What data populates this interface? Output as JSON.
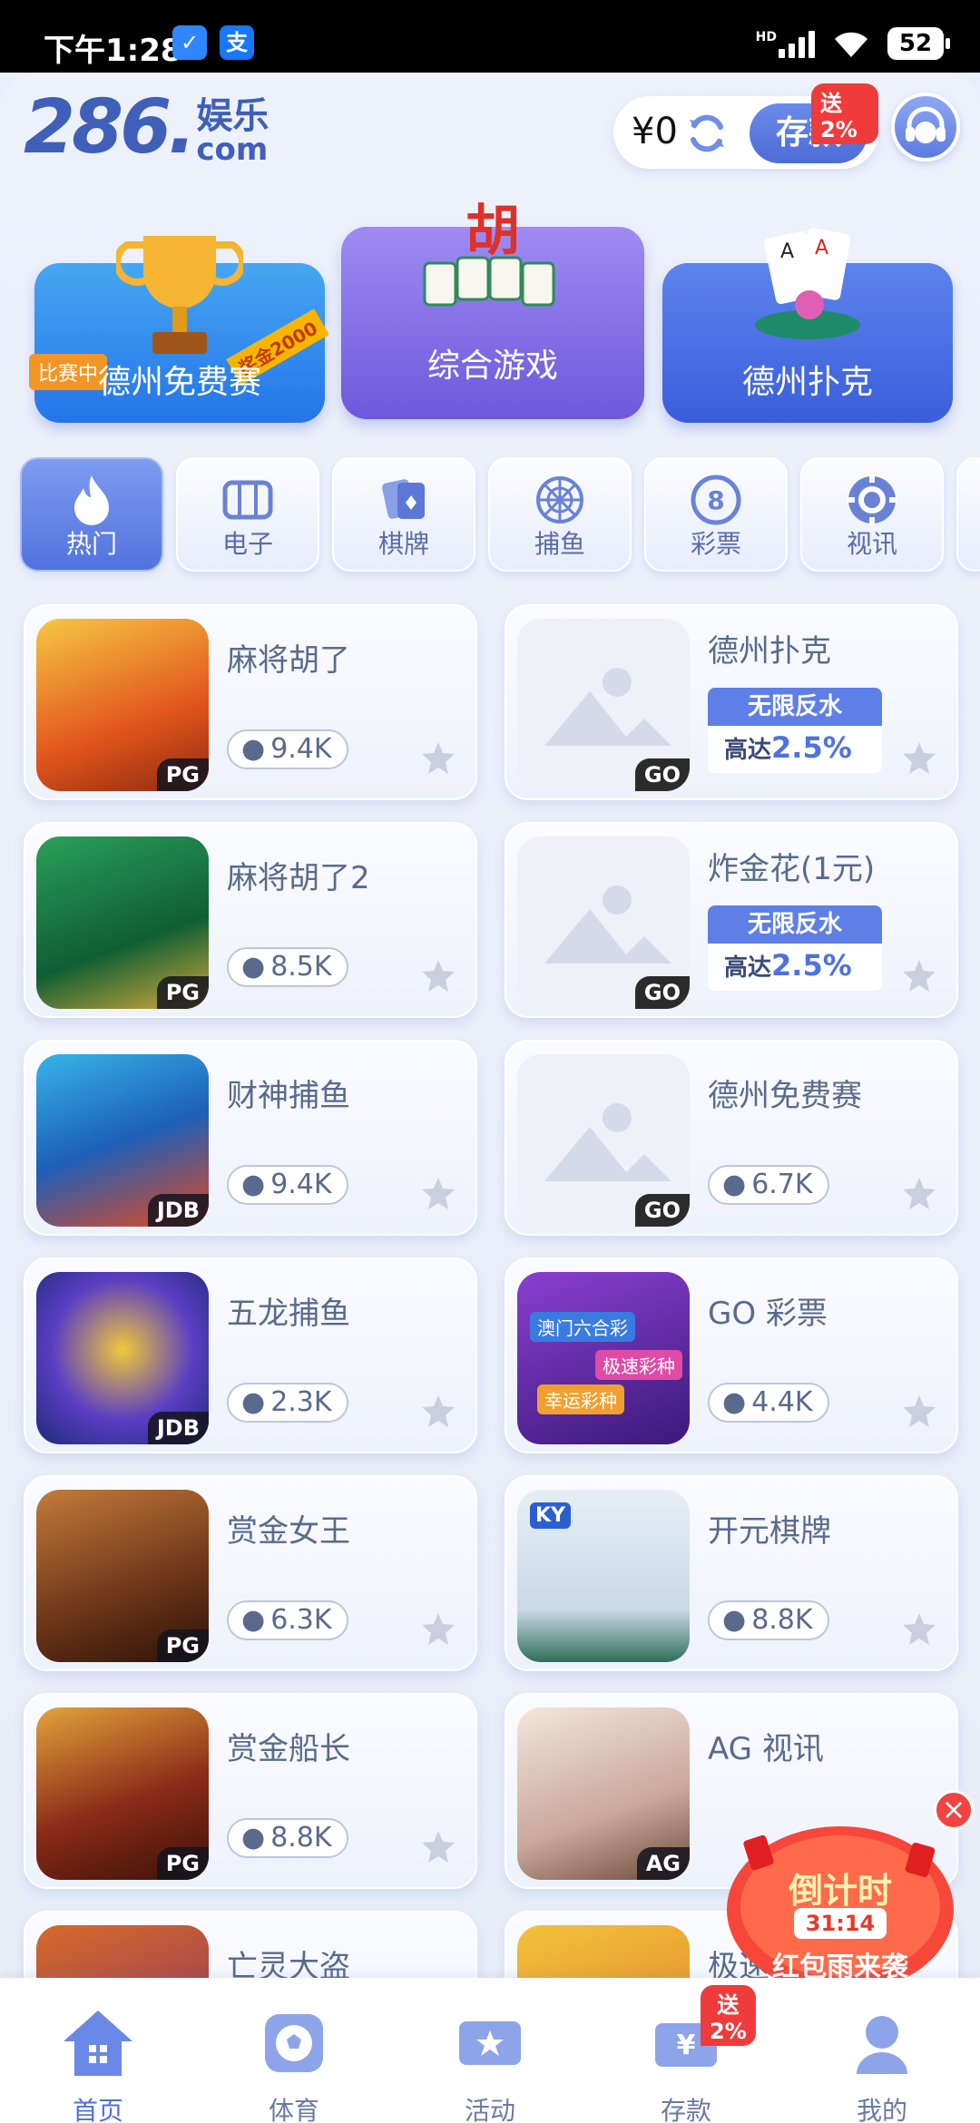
{
  "status_bar": {
    "time": "下午1:28",
    "battery": "52",
    "network": "HD"
  },
  "header": {
    "logo_number": "286.",
    "logo_cn": "娱乐",
    "logo_com": "com",
    "balance": "¥0",
    "deposit_label": "存款",
    "deposit_promo": "送2%"
  },
  "banners": [
    {
      "label": "德州免费赛",
      "tag": "比赛中",
      "ribbon": "奖金2000"
    },
    {
      "label": "综合游戏",
      "emblem": "胡"
    },
    {
      "label": "德州扑克"
    }
  ],
  "categories": [
    {
      "label": "热门",
      "icon": "flame-icon",
      "active": true
    },
    {
      "label": "电子",
      "icon": "slot-machine-icon"
    },
    {
      "label": "棋牌",
      "icon": "cards-icon"
    },
    {
      "label": "捕鱼",
      "icon": "net-icon"
    },
    {
      "label": "彩票",
      "icon": "lottery-ball-icon"
    },
    {
      "label": "视讯",
      "icon": "chip-icon"
    }
  ],
  "rebate": {
    "title": "无限反水",
    "prefix": "高达",
    "rate": "2.5%"
  },
  "games_left": [
    {
      "name": "麻将胡了",
      "players": "9.4K",
      "provider": "PG"
    },
    {
      "name": "麻将胡了2",
      "players": "8.5K",
      "provider": "PG"
    },
    {
      "name": "财神捕鱼",
      "players": "9.4K",
      "provider": "JDB"
    },
    {
      "name": "五龙捕鱼",
      "players": "2.3K",
      "provider": "JDB"
    },
    {
      "name": "赏金女王",
      "players": "6.3K",
      "provider": "PG"
    },
    {
      "name": "赏金船长",
      "players": "8.8K",
      "provider": "PG"
    },
    {
      "name": "亡灵大盗"
    }
  ],
  "games_right": [
    {
      "name": "德州扑克",
      "provider": "GO"
    },
    {
      "name": "炸金花(1元)",
      "provider": "GO"
    },
    {
      "name": "德州免费赛",
      "players": "6.7K",
      "provider": "GO"
    },
    {
      "name": "GO 彩票",
      "players": "4.4K",
      "thumb_text": [
        "澳门六合彩",
        "极速彩种",
        "幸运彩种"
      ]
    },
    {
      "name": "开元棋牌",
      "players": "8.8K",
      "thumb_text": [
        "KY"
      ]
    },
    {
      "name": "AG 视讯",
      "provider": "AG"
    },
    {
      "name": "极速时时彩"
    }
  ],
  "countdown": {
    "title": "倒计时",
    "time": "31:14",
    "subtitle": "红包雨来袭"
  },
  "bottom_nav": [
    {
      "label": "首页",
      "icon": "home-icon"
    },
    {
      "label": "体育",
      "icon": "soccer-ball-icon"
    },
    {
      "label": "活动",
      "icon": "ticket-icon"
    },
    {
      "label": "存款",
      "icon": "wallet-icon",
      "badge": "送2%"
    },
    {
      "label": "我的",
      "icon": "user-icon"
    }
  ],
  "colors": {
    "accent": "#5173de",
    "background": "#e9eefb",
    "promo_red": "#ef3b3b"
  }
}
